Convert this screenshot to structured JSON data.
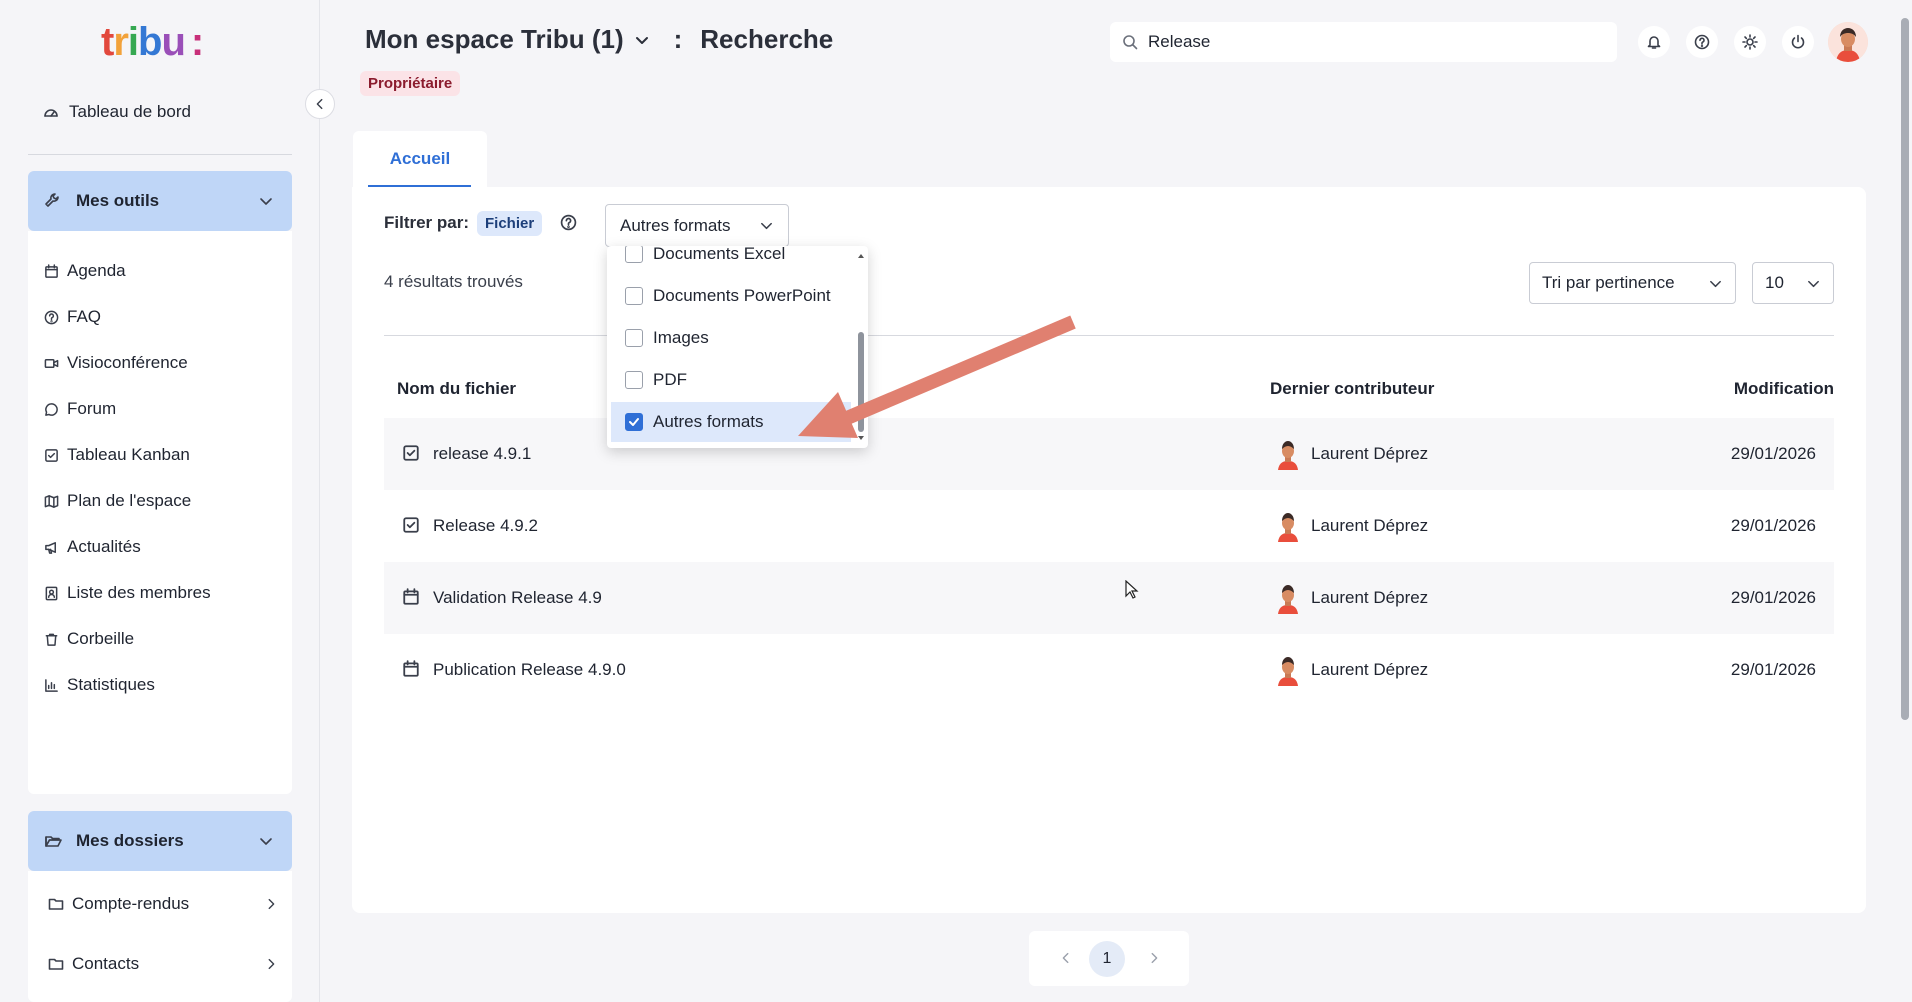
{
  "colors": {
    "accent": "#2f6fd6",
    "section_bg": "#bfd6f7",
    "badge_bg": "#fbe3e7",
    "arrow": "#e08070"
  },
  "logo": {
    "text": "tribu:"
  },
  "sidebar": {
    "dashboard": {
      "label": "Tableau de bord",
      "icon": "gauge-icon"
    },
    "tools": {
      "title": "Mes outils",
      "items": [
        {
          "label": "Agenda",
          "icon": "calendar-icon"
        },
        {
          "label": "FAQ",
          "icon": "help-circle-icon"
        },
        {
          "label": "Visioconférence",
          "icon": "video-icon"
        },
        {
          "label": "Forum",
          "icon": "chat-icon"
        },
        {
          "label": "Tableau Kanban",
          "icon": "checkbox-icon"
        },
        {
          "label": "Plan de l'espace",
          "icon": "map-icon"
        },
        {
          "label": "Actualités",
          "icon": "megaphone-icon"
        },
        {
          "label": "Liste des membres",
          "icon": "contacts-icon"
        },
        {
          "label": "Corbeille",
          "icon": "trash-icon"
        },
        {
          "label": "Statistiques",
          "icon": "bar-chart-icon"
        }
      ]
    },
    "folders": {
      "title": "Mes dossiers",
      "items": [
        {
          "label": "Compte-rendus",
          "icon": "folder-icon"
        },
        {
          "label": "Contacts",
          "icon": "folder-icon"
        }
      ]
    }
  },
  "header": {
    "space_name": "Mon espace Tribu (1)",
    "separator": ":",
    "page": "Recherche",
    "role_badge": "Propriétaire",
    "search": {
      "value": "Release",
      "placeholder": ""
    }
  },
  "tabs": [
    {
      "label": "Accueil",
      "active": true
    }
  ],
  "filters": {
    "label": "Filtrer par:",
    "chip": "Fichier",
    "format_selected": "Autres formats",
    "options": [
      {
        "label": "Documents Excel",
        "checked": false
      },
      {
        "label": "Documents PowerPoint",
        "checked": false
      },
      {
        "label": "Images",
        "checked": false
      },
      {
        "label": "PDF",
        "checked": false
      },
      {
        "label": "Autres formats",
        "checked": true
      }
    ]
  },
  "results": {
    "count_text": "4 résultats trouvés",
    "sort": "Tri par pertinence",
    "per_page": "10",
    "columns": {
      "name": "Nom du fichier",
      "contributor": "Dernier contributeur",
      "modified": "Modification"
    },
    "rows": [
      {
        "name": "release 4.9.1",
        "icon": "task-check-icon",
        "contributor": "Laurent Déprez",
        "date": "29/01/2026"
      },
      {
        "name": "Release 4.9.2",
        "icon": "task-check-icon",
        "contributor": "Laurent Déprez",
        "date": "29/01/2026"
      },
      {
        "name": "Validation Release 4.9",
        "icon": "calendar-icon",
        "contributor": "Laurent Déprez",
        "date": "29/01/2026"
      },
      {
        "name": "Publication Release 4.9.0",
        "icon": "calendar-icon",
        "contributor": "Laurent Déprez",
        "date": "29/01/2026"
      }
    ]
  },
  "pagination": {
    "current": "1"
  }
}
